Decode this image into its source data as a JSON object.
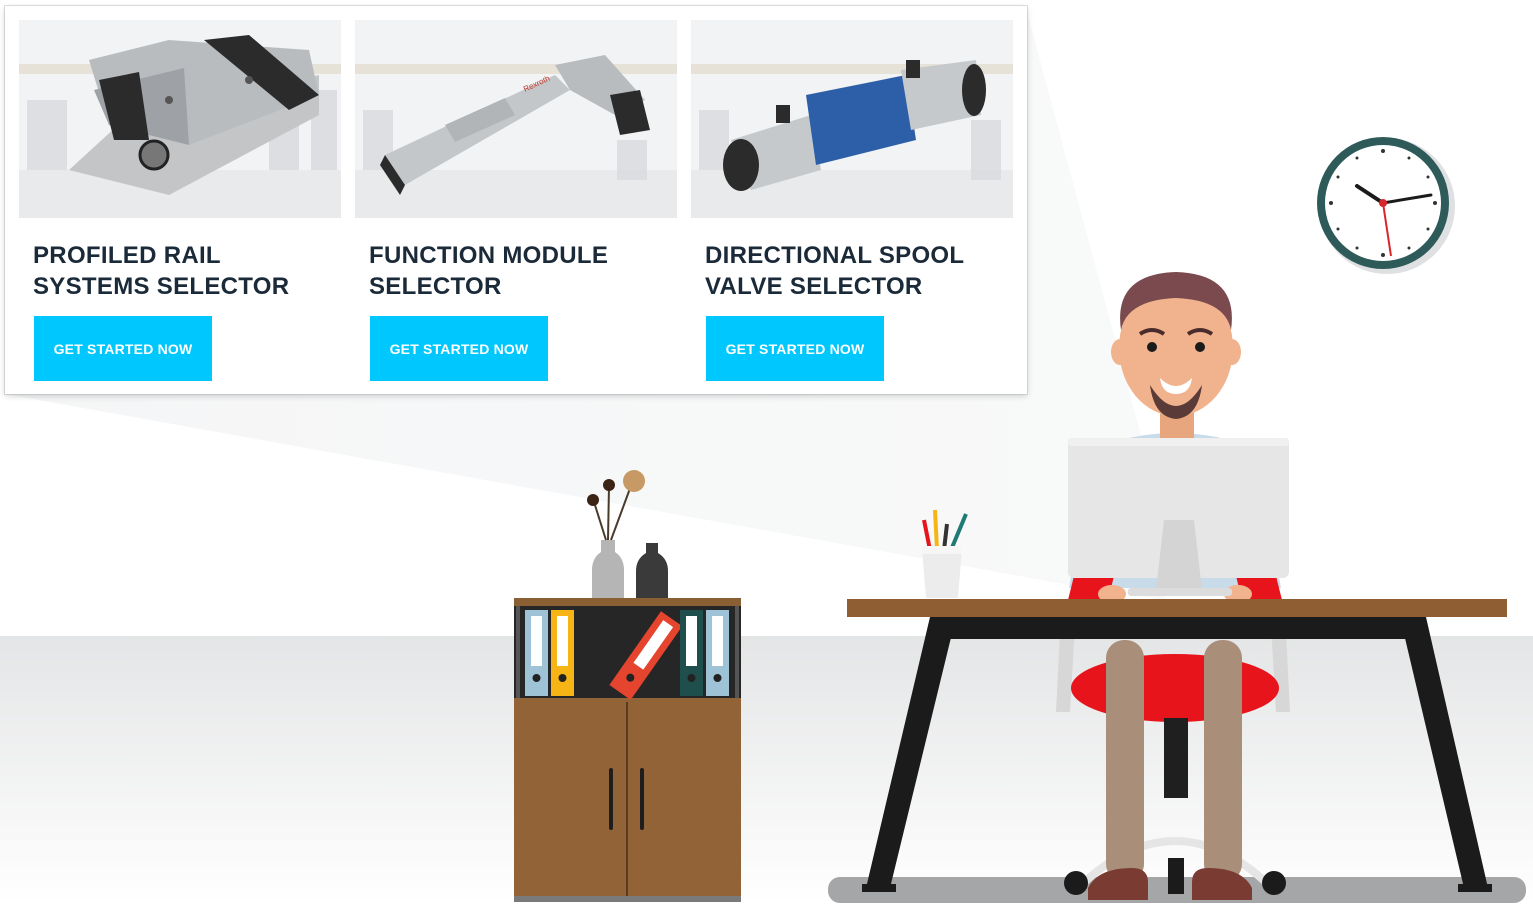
{
  "selectors": [
    {
      "title_line1": "PROFILED RAIL",
      "title_line2": "SYSTEMS SELECTOR",
      "button_label": "GET STARTED NOW",
      "image": "profiled-rail-block-photo"
    },
    {
      "title_line1": "FUNCTION MODULE",
      "title_line2": "SELECTOR",
      "button_label": "GET STARTED NOW",
      "image": "linear-function-module-photo"
    },
    {
      "title_line1": "DIRECTIONAL SPOOL",
      "title_line2": "VALVE SELECTOR",
      "button_label": "GET STARTED NOW",
      "image": "directional-spool-valve-photo"
    }
  ],
  "colors": {
    "button": "#00c8ff",
    "title_text": "#1b2a38",
    "desk_wood": "#8a5f33",
    "chair_red": "#e8141b",
    "clock_rim": "#2e5a5a"
  },
  "icons": [
    "clock-icon",
    "pencil-cup-icon",
    "binder-icon",
    "vase-icon",
    "monitor-icon"
  ]
}
